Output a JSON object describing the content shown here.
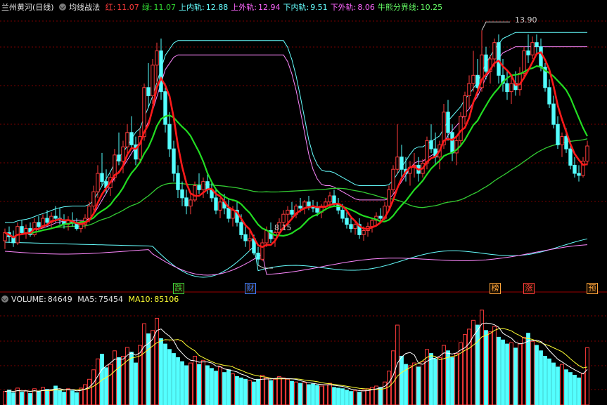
{
  "header": {
    "title": "兰州黄河(日线)",
    "indicator_name": "均线战法",
    "items": [
      {
        "label": "红:",
        "value": "11.07",
        "color": "#ff3b3b"
      },
      {
        "label": "绿:",
        "value": "11.07",
        "color": "#33dd33"
      },
      {
        "label": "上内轨:",
        "value": "12.88",
        "color": "#66ffff"
      },
      {
        "label": "上外轨:",
        "value": "12.94",
        "color": "#ff66ff"
      },
      {
        "label": "下内轨:",
        "value": "9.51",
        "color": "#66ffff"
      },
      {
        "label": "下外轨:",
        "value": "8.06",
        "color": "#ff66ff"
      },
      {
        "label": "牛熊分界线:",
        "value": "10.25",
        "color": "#66ff66"
      }
    ]
  },
  "volume_header": {
    "label": "VOLUME:",
    "value": "84649",
    "ma5_label": "MA5:",
    "ma5_value": "75454",
    "ma10_label": "MA10:",
    "ma10_value": "85106"
  },
  "annotations": {
    "high": "13.90",
    "low": "8.15"
  },
  "event_markers": [
    {
      "text": "跌",
      "color": "#3bd13b",
      "x_index": 41
    },
    {
      "text": "财",
      "color": "#3b7bff",
      "x_index": 58
    },
    {
      "text": "榜",
      "color": "#ffa53b",
      "x_index": 116
    },
    {
      "text": "涨",
      "color": "#ff3b3b",
      "x_index": 124
    },
    {
      "text": "预",
      "color": "#ffa53b",
      "x_index": 139
    }
  ],
  "colors": {
    "up": "#ff3b3b",
    "down": "#54ffff",
    "grid": "#7a0000",
    "ma_red": "#ff1a1a",
    "ma_green": "#22dd22",
    "bull_bear": "#33cc33",
    "band_inner": "#66ffff",
    "band_outer": "#ff88ff",
    "vol_ma5": "#ffffff",
    "vol_ma10": "#ffff33"
  },
  "chart_data": {
    "type": "candlestick",
    "price_ylim": [
      7.6,
      14.3
    ],
    "volume_ylim": [
      0,
      145000
    ],
    "ohlc": [
      [
        8.75,
        9.05,
        8.55,
        8.95
      ],
      [
        8.95,
        9.1,
        8.7,
        8.85
      ],
      [
        8.85,
        9.0,
        8.6,
        8.7
      ],
      [
        8.7,
        9.2,
        8.65,
        9.1
      ],
      [
        9.1,
        9.25,
        8.9,
        8.95
      ],
      [
        8.95,
        9.15,
        8.8,
        9.05
      ],
      [
        9.05,
        9.2,
        8.85,
        8.9
      ],
      [
        8.9,
        9.3,
        8.85,
        9.2
      ],
      [
        9.2,
        9.35,
        9.0,
        9.1
      ],
      [
        9.1,
        9.4,
        9.05,
        9.3
      ],
      [
        9.3,
        9.5,
        9.1,
        9.2
      ],
      [
        9.2,
        9.45,
        9.05,
        9.35
      ],
      [
        9.35,
        9.6,
        9.2,
        9.3
      ],
      [
        9.3,
        9.55,
        9.15,
        9.25
      ],
      [
        9.25,
        9.4,
        9.05,
        9.15
      ],
      [
        9.15,
        9.35,
        9.0,
        9.25
      ],
      [
        9.25,
        9.45,
        9.1,
        9.2
      ],
      [
        9.2,
        9.3,
        9.0,
        9.05
      ],
      [
        9.05,
        9.25,
        8.95,
        9.15
      ],
      [
        9.15,
        9.4,
        9.05,
        9.3
      ],
      [
        9.3,
        9.7,
        9.2,
        9.6
      ],
      [
        9.6,
        10.1,
        9.5,
        9.95
      ],
      [
        9.95,
        10.6,
        9.8,
        10.4
      ],
      [
        10.4,
        10.9,
        10.1,
        10.2
      ],
      [
        10.2,
        10.5,
        9.9,
        10.05
      ],
      [
        10.05,
        10.4,
        9.85,
        10.3
      ],
      [
        10.3,
        11.0,
        10.2,
        10.85
      ],
      [
        10.85,
        11.4,
        10.6,
        10.7
      ],
      [
        10.7,
        11.2,
        10.4,
        11.05
      ],
      [
        11.05,
        11.6,
        10.8,
        11.4
      ],
      [
        11.4,
        11.8,
        11.0,
        11.1
      ],
      [
        11.1,
        11.3,
        10.6,
        10.75
      ],
      [
        10.75,
        11.5,
        10.7,
        11.3
      ],
      [
        11.3,
        12.6,
        11.2,
        12.5
      ],
      [
        12.5,
        13.1,
        12.0,
        12.3
      ],
      [
        12.3,
        13.2,
        12.1,
        13.05
      ],
      [
        13.05,
        13.6,
        12.6,
        13.4
      ],
      [
        13.4,
        13.7,
        12.2,
        12.4
      ],
      [
        12.4,
        12.6,
        11.4,
        11.6
      ],
      [
        11.6,
        11.9,
        10.8,
        11.0
      ],
      [
        11.0,
        11.2,
        10.2,
        10.4
      ],
      [
        10.4,
        10.6,
        9.8,
        10.0
      ],
      [
        10.0,
        10.2,
        9.6,
        9.8
      ],
      [
        9.8,
        10.0,
        9.4,
        9.6
      ],
      [
        9.6,
        9.9,
        9.4,
        9.75
      ],
      [
        9.75,
        10.2,
        9.7,
        10.1
      ],
      [
        10.1,
        10.4,
        9.9,
        10.0
      ],
      [
        10.0,
        10.3,
        9.8,
        10.2
      ],
      [
        10.2,
        10.4,
        9.9,
        10.0
      ],
      [
        10.0,
        10.2,
        9.7,
        9.8
      ],
      [
        9.8,
        10.0,
        9.4,
        9.5
      ],
      [
        9.5,
        9.8,
        9.3,
        9.7
      ],
      [
        9.7,
        9.9,
        9.4,
        9.55
      ],
      [
        9.55,
        9.8,
        9.2,
        9.3
      ],
      [
        9.3,
        9.6,
        9.1,
        9.5
      ],
      [
        9.5,
        9.7,
        9.1,
        9.2
      ],
      [
        9.2,
        9.4,
        8.8,
        8.9
      ],
      [
        8.9,
        9.1,
        8.6,
        8.75
      ],
      [
        8.75,
        9.0,
        8.5,
        8.8
      ],
      [
        8.8,
        8.9,
        8.4,
        8.45
      ],
      [
        8.45,
        8.6,
        8.15,
        8.3
      ],
      [
        8.3,
        8.8,
        8.25,
        8.7
      ],
      [
        8.7,
        9.1,
        8.6,
        9.0
      ],
      [
        9.0,
        9.2,
        8.7,
        8.8
      ],
      [
        8.8,
        9.0,
        8.6,
        8.95
      ],
      [
        8.95,
        9.3,
        8.9,
        9.2
      ],
      [
        9.2,
        9.5,
        9.1,
        9.4
      ],
      [
        9.4,
        9.6,
        9.2,
        9.5
      ],
      [
        9.5,
        9.7,
        9.3,
        9.4
      ],
      [
        9.4,
        9.65,
        9.3,
        9.6
      ],
      [
        9.6,
        9.8,
        9.45,
        9.55
      ],
      [
        9.55,
        9.75,
        9.4,
        9.7
      ],
      [
        9.7,
        9.85,
        9.5,
        9.6
      ],
      [
        9.6,
        9.75,
        9.45,
        9.55
      ],
      [
        9.55,
        9.7,
        9.35,
        9.45
      ],
      [
        9.45,
        9.65,
        9.3,
        9.6
      ],
      [
        9.6,
        9.8,
        9.5,
        9.7
      ],
      [
        9.7,
        9.95,
        9.55,
        9.85
      ],
      [
        9.85,
        10.0,
        9.6,
        9.65
      ],
      [
        9.65,
        9.8,
        9.4,
        9.5
      ],
      [
        9.5,
        9.65,
        9.2,
        9.3
      ],
      [
        9.3,
        9.45,
        9.05,
        9.15
      ],
      [
        9.15,
        9.3,
        8.95,
        9.05
      ],
      [
        9.05,
        9.25,
        8.9,
        9.15
      ],
      [
        9.15,
        9.3,
        8.8,
        8.9
      ],
      [
        8.9,
        9.1,
        8.75,
        9.0
      ],
      [
        9.0,
        9.2,
        8.85,
        9.1
      ],
      [
        9.1,
        9.3,
        8.95,
        9.25
      ],
      [
        9.25,
        9.45,
        9.1,
        9.35
      ],
      [
        9.35,
        9.55,
        9.2,
        9.3
      ],
      [
        9.3,
        9.7,
        9.25,
        9.6
      ],
      [
        9.6,
        10.1,
        9.5,
        10.0
      ],
      [
        10.0,
        10.6,
        9.9,
        10.5
      ],
      [
        10.5,
        11.6,
        10.4,
        10.8
      ],
      [
        10.8,
        11.1,
        10.3,
        10.5
      ],
      [
        10.5,
        10.8,
        10.2,
        10.4
      ],
      [
        10.4,
        10.7,
        10.1,
        10.55
      ],
      [
        10.55,
        10.9,
        10.3,
        10.6
      ],
      [
        10.6,
        10.8,
        10.2,
        10.4
      ],
      [
        10.4,
        10.75,
        10.3,
        10.65
      ],
      [
        10.65,
        11.3,
        10.5,
        11.2
      ],
      [
        11.2,
        11.6,
        10.9,
        11.0
      ],
      [
        11.0,
        11.4,
        10.6,
        10.8
      ],
      [
        10.8,
        11.2,
        10.5,
        11.1
      ],
      [
        11.1,
        12.1,
        11.0,
        11.9
      ],
      [
        11.9,
        12.2,
        11.2,
        11.4
      ],
      [
        11.4,
        11.6,
        10.7,
        10.9
      ],
      [
        10.9,
        11.3,
        10.6,
        11.2
      ],
      [
        11.2,
        11.9,
        11.1,
        11.8
      ],
      [
        11.8,
        12.4,
        11.6,
        12.3
      ],
      [
        12.3,
        12.8,
        12.0,
        12.6
      ],
      [
        12.6,
        13.4,
        12.4,
        12.8
      ],
      [
        12.8,
        13.2,
        12.3,
        12.5
      ],
      [
        12.5,
        13.9,
        12.4,
        13.3
      ],
      [
        13.3,
        13.5,
        12.7,
        12.9
      ],
      [
        12.9,
        13.3,
        12.6,
        13.2
      ],
      [
        13.2,
        13.7,
        13.0,
        13.6
      ],
      [
        13.6,
        13.8,
        12.6,
        12.8
      ],
      [
        12.8,
        13.2,
        12.4,
        12.6
      ],
      [
        12.6,
        12.9,
        12.2,
        12.4
      ],
      [
        12.4,
        12.8,
        12.1,
        12.6
      ],
      [
        12.6,
        12.9,
        12.3,
        12.45
      ],
      [
        12.45,
        13.0,
        12.3,
        12.85
      ],
      [
        12.85,
        13.5,
        12.7,
        13.4
      ],
      [
        13.4,
        13.8,
        13.1,
        13.3
      ],
      [
        13.3,
        13.75,
        13.2,
        13.6
      ],
      [
        13.6,
        13.8,
        13.3,
        13.5
      ],
      [
        13.5,
        13.7,
        12.9,
        13.0
      ],
      [
        13.0,
        13.1,
        12.4,
        12.5
      ],
      [
        12.5,
        12.7,
        12.0,
        12.1
      ],
      [
        12.1,
        12.3,
        11.5,
        11.6
      ],
      [
        11.6,
        11.8,
        11.0,
        11.1
      ],
      [
        11.1,
        11.4,
        10.8,
        11.3
      ],
      [
        11.3,
        11.5,
        10.9,
        11.0
      ],
      [
        11.0,
        11.2,
        10.5,
        10.6
      ],
      [
        10.6,
        10.8,
        10.3,
        10.4
      ],
      [
        10.4,
        10.6,
        10.2,
        10.35
      ],
      [
        10.35,
        10.8,
        10.3,
        10.7
      ],
      [
        10.7,
        11.2,
        10.6,
        11.07
      ]
    ],
    "volume": [
      20000,
      22000,
      18000,
      25000,
      19000,
      21000,
      17000,
      24000,
      20000,
      26000,
      23000,
      21000,
      28000,
      22000,
      19000,
      24000,
      21000,
      18000,
      25000,
      30000,
      38000,
      52000,
      68000,
      75000,
      55000,
      60000,
      80000,
      70000,
      72000,
      85000,
      78000,
      62000,
      88000,
      120000,
      105000,
      110000,
      128000,
      98000,
      90000,
      82000,
      76000,
      70000,
      64000,
      58000,
      62000,
      72000,
      60000,
      66000,
      58000,
      54000,
      50000,
      56000,
      48000,
      52000,
      46000,
      42000,
      40000,
      38000,
      36000,
      34000,
      38000,
      44000,
      40000,
      36000,
      38000,
      42000,
      40000,
      38000,
      35000,
      34000,
      32000,
      33000,
      30000,
      31000,
      29000,
      28000,
      30000,
      32000,
      26000,
      25000,
      24000,
      22000,
      20000,
      21000,
      19000,
      22000,
      24000,
      26000,
      28000,
      26000,
      34000,
      50000,
      80000,
      118000,
      72000,
      60000,
      58000,
      62000,
      56000,
      64000,
      82000,
      76000,
      68000,
      70000,
      88000,
      80000,
      70000,
      76000,
      92000,
      104000,
      112000,
      125000,
      118000,
      140000,
      110000,
      108000,
      116000,
      100000,
      96000,
      90000,
      92000,
      84000,
      90000,
      100000,
      106000,
      94000,
      88000,
      80000,
      72000,
      68000,
      62000,
      56000,
      60000,
      52000,
      48000,
      44000,
      40000,
      46000,
      84649
    ]
  }
}
